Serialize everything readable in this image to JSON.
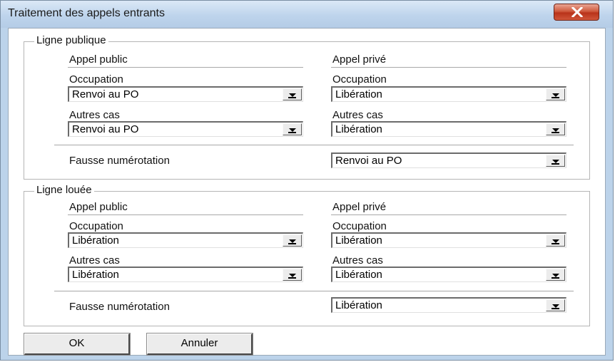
{
  "window": {
    "title": "Traitement des appels entrants",
    "close_icon": "close-icon"
  },
  "public_group": {
    "legend": "Ligne publique",
    "public_call": {
      "header": "Appel public",
      "occupation_label": "Occupation",
      "occupation_value": "Renvoi au PO",
      "other_label": "Autres cas",
      "other_value": "Renvoi au PO"
    },
    "private_call": {
      "header": "Appel privé",
      "occupation_label": "Occupation",
      "occupation_value": "Libération",
      "other_label": "Autres cas",
      "other_value": "Libération"
    },
    "wrong_number_label": "Fausse numérotation",
    "wrong_number_value": "Renvoi au PO"
  },
  "leased_group": {
    "legend": "Ligne louée",
    "public_call": {
      "header": "Appel public",
      "occupation_label": "Occupation",
      "occupation_value": "Libération",
      "other_label": "Autres cas",
      "other_value": "Libération"
    },
    "private_call": {
      "header": "Appel privé",
      "occupation_label": "Occupation",
      "occupation_value": "Libération",
      "other_label": "Autres cas",
      "other_value": "Libération"
    },
    "wrong_number_label": "Fausse numérotation",
    "wrong_number_value": "Libération"
  },
  "buttons": {
    "ok": "OK",
    "cancel": "Annuler"
  }
}
